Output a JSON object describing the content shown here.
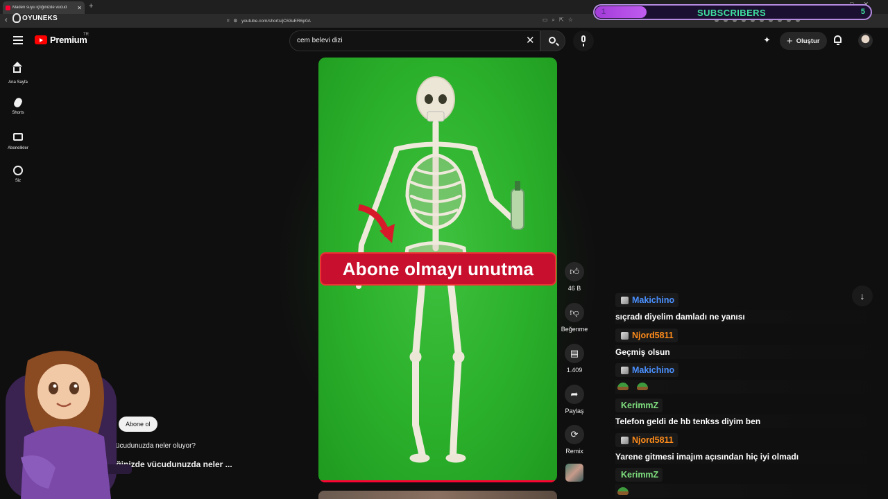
{
  "browser": {
    "tab_title": "Maden suyu içtiğinizde vücud",
    "url": "youtube.com/shorts/jC63uER6p0A"
  },
  "overlay": {
    "logo_text": "OYUNEKS",
    "subscribers": {
      "current": "1",
      "label": "SUBSCRIBERS",
      "goal": "5",
      "progress": 0.2
    }
  },
  "header": {
    "logo_word": "Premium",
    "country": "TR",
    "search_value": "cem belevi dizi",
    "create_label": "Oluştur"
  },
  "sidebar": {
    "items": [
      {
        "label": "Ana Sayfa",
        "icon": "home-icon"
      },
      {
        "label": "Shorts",
        "icon": "shorts-icon"
      },
      {
        "label": "Abonelikler",
        "icon": "subscriptions-icon"
      },
      {
        "label": "Siz",
        "icon": "you-icon"
      }
    ]
  },
  "video": {
    "banner_text": "Abone olmayı unutma"
  },
  "actions": {
    "like_count": "46 B",
    "dislike_label": "Beğenme",
    "comment_count": "1.409",
    "share_label": "Paylaş",
    "remix_label": "Remix"
  },
  "shorts_info": {
    "channel_partial": "ti",
    "subscribe_label": "Abone ol",
    "subtitle": "de vücudunuzda neler oluyor?",
    "title": "içtiğinizde vücudunuzda neler ..."
  },
  "chat": [
    {
      "user": "Makichino",
      "color": "#4a90ff",
      "text": "sıçradı diyelim damladı ne yanısı",
      "badge": true
    },
    {
      "user": "Njord5811",
      "color": "#ff8c1a",
      "text": "Geçmiş olsun",
      "badge": true
    },
    {
      "user": "Makichino",
      "color": "#4a90ff",
      "text": "",
      "emotes": 2,
      "badge": true
    },
    {
      "user": "KerimmZ",
      "color": "#7fe07f",
      "text": "Telefon geldi de hb tenkss diyim ben",
      "badge": false
    },
    {
      "user": "Njord5811",
      "color": "#ff8c1a",
      "text": "Yarene gitmesi imajım açısından hiç iyi olmadı",
      "badge": true
    },
    {
      "user": "KerimmZ",
      "color": "#7fe07f",
      "text": "",
      "emotes": 1,
      "badge": false
    }
  ]
}
